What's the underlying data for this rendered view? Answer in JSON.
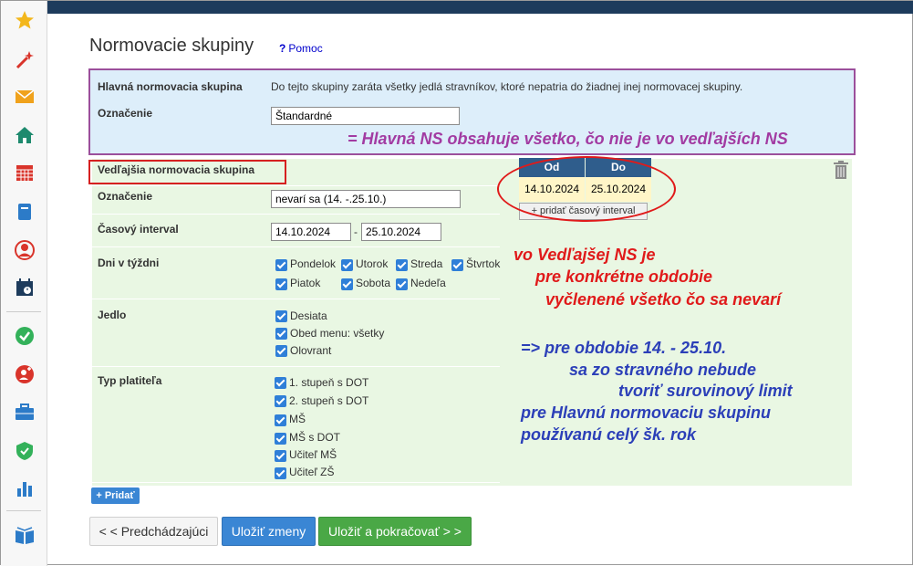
{
  "page": {
    "title": "Normovacie skupiny",
    "help_label": "Pomoc",
    "help_symbol": "?"
  },
  "main_group": {
    "title": "Hlavná normovacia skupina",
    "description": "Do tejto skupiny zaráta všetky jedlá stravníkov, ktoré nepatria do žiadnej inej normovacej skupiny.",
    "designation_label": "Označenie",
    "designation_value": "Štandardné",
    "annotation": "= Hlavná NS obsahuje všetko, čo nie je vo vedľajších NS"
  },
  "side_group": {
    "title": "Vedľajšia normovacia skupina",
    "designation_label": "Označenie",
    "designation_value": "nevarí sa (14. -.25.10.)",
    "interval_label": "Časový interval",
    "interval_from": "14.10.2024",
    "interval_separator": "-",
    "interval_to": "25.10.2024",
    "weekdays_label": "Dni v týždni",
    "weekdays": [
      "Pondelok",
      "Utorok",
      "Streda",
      "Štvrtok",
      "Piatok",
      "Sobota",
      "Nedeľa"
    ],
    "meals_label": "Jedlo",
    "meals": [
      "Desiata",
      "Obed  menu: všetky",
      "Olovrant"
    ],
    "payer_label": "Typ platiteľa",
    "payers": [
      "1. stupeň s DOT",
      "2. stupeň s DOT",
      "MŠ",
      "MŠ s DOT",
      "Učiteľ MŠ",
      "Učiteľ ZŠ"
    ]
  },
  "interval_table": {
    "header_from": "Od",
    "header_to": "Do",
    "from": "14.10.2024",
    "to": "25.10.2024",
    "add_button": "+ pridať časový interval"
  },
  "annotations": {
    "red": [
      "vo Vedľajšej NS je",
      "pre konkrétne obdobie",
      "vyčlenené všetko čo sa nevarí"
    ],
    "blue": [
      "=> pre obdobie 14. - 25.10.",
      "sa zo stravného nebude",
      "tvoriť surovinový limit",
      "pre Hlavnú normovaciu skupinu",
      "používanú celý šk. rok"
    ]
  },
  "buttons": {
    "add": "+ Pridať",
    "previous": "< < Predchádzajúci",
    "save": "Uložiť zmeny",
    "save_continue": "Uložiť a pokračovať > >"
  },
  "sidebar_icons": [
    "star-icon",
    "magic-wand-icon",
    "envelope-icon",
    "home-icon",
    "calendar-icon",
    "book-icon",
    "user-icon",
    "schedule-icon",
    "check-circle-icon",
    "add-user-icon",
    "briefcase-icon",
    "shield-check-icon",
    "bar-chart-icon",
    "open-book-icon"
  ],
  "colors": {
    "topbar": "#1d3b5c",
    "main_group_bg": "#ddeefa",
    "main_group_border": "#9b4f9b",
    "side_group_bg": "#e9f7e3",
    "annotation_red": "#e01a1a",
    "annotation_blue": "#2b3fb8",
    "annotation_purple": "#a23ba2",
    "primary_button": "#3a86d4",
    "success_button": "#4aa846"
  }
}
